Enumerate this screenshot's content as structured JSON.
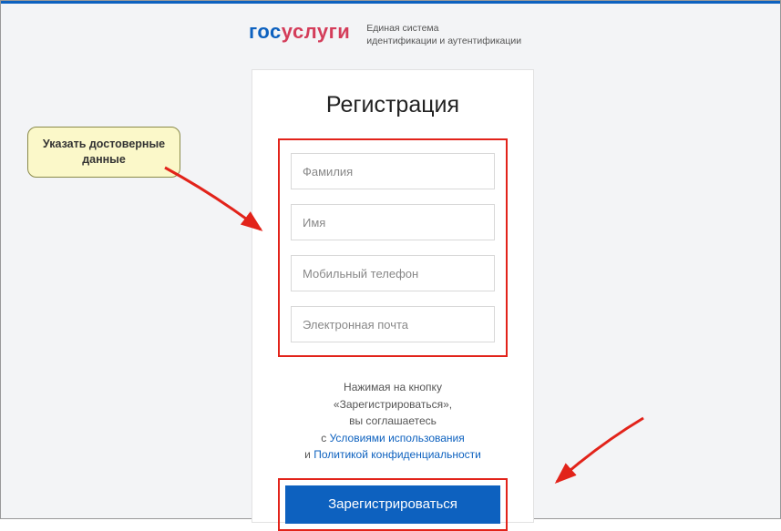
{
  "logo": {
    "part1": "гос",
    "part2": "услуги"
  },
  "subtitle_line1": "Единая система",
  "subtitle_line2": "идентификации и аутентификации",
  "title": "Регистрация",
  "fields": {
    "surname": "Фамилия",
    "name": "Имя",
    "phone": "Мобильный телефон",
    "email": "Электронная почта"
  },
  "consent": {
    "line1": "Нажимая на кнопку",
    "line2": "«Зарегистрироваться»,",
    "line3": "вы соглашаетесь",
    "prefix_terms": "с ",
    "terms": "Условиями использования",
    "prefix_privacy": "и ",
    "privacy": "Политикой конфиденциальности"
  },
  "button": "Зарегистрироваться",
  "callout": "Указать достоверные данные"
}
